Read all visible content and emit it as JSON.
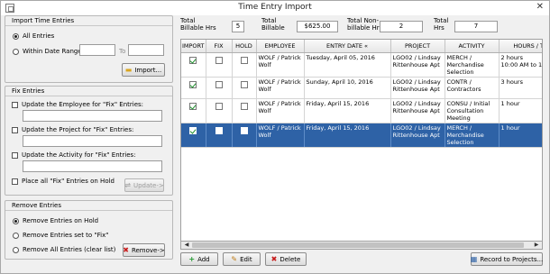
{
  "window": {
    "title": "Time Entry Import",
    "close_glyph": "✕"
  },
  "import_group": {
    "label": "Import Time Entries",
    "all_entries": "All Entries",
    "within_range": "Within Date Range:",
    "to_label": "To",
    "import_button": "Import..."
  },
  "fix_group": {
    "label": "Fix Entries",
    "update_employee": "Update the Employee for \"Fix\" Entries:",
    "update_project": "Update the Project for \"Fix\" Entries:",
    "update_activity": "Update the Activity for \"Fix\" Entries:",
    "place_on_hold": "Place all \"Fix\" Entries on Hold",
    "update_button": "Update->"
  },
  "remove_group": {
    "label": "Remove Entries",
    "remove_on_hold": "Remove Entries on Hold",
    "remove_fix": "Remove Entries set to \"Fix\"",
    "remove_all": "Remove All Entries (clear list)",
    "remove_button": "Remove->"
  },
  "stats": {
    "total_billable_hrs_label": "Total\nBillable Hrs",
    "total_billable_hrs": "5",
    "total_billable_label": "Total\nBillable",
    "total_billable": "$625.00",
    "total_nonbillable_label": "Total Non-\nbillable Hrs",
    "total_nonbillable": "2",
    "total_hrs_label": "Total\nHrs",
    "total_hrs": "7"
  },
  "grid": {
    "columns": [
      "IMPORT",
      "FIX",
      "HOLD",
      "EMPLOYEE",
      "ENTRY DATE «",
      "PROJECT",
      "ACTIVITY",
      "HOURS / TIME"
    ],
    "rows": [
      {
        "import": true,
        "fix": false,
        "hold": false,
        "employee": "WOLF / Patrick Wolf",
        "date": "Tuesday, April 05, 2016",
        "project": "LGO02 / Lindsay Rittenhouse Apt",
        "activity": "MERCH / Merchandise Selection",
        "hours": "2 hours\n10:00 AM to 12:00 PM"
      },
      {
        "import": true,
        "fix": false,
        "hold": false,
        "employee": "WOLF / Patrick Wolf",
        "date": "Sunday, April 10, 2016",
        "project": "LGO02 / Lindsay Rittenhouse Apt",
        "activity": "CONTR / Contractors",
        "hours": "3 hours"
      },
      {
        "import": true,
        "fix": false,
        "hold": false,
        "employee": "WOLF / Patrick Wolf",
        "date": "Friday, April 15, 2016",
        "project": "LGO02 / Lindsay Rittenhouse Apt",
        "activity": "CONSU / Initial Consultation Meeting",
        "hours": "1 hour"
      },
      {
        "import": true,
        "fix": false,
        "hold": false,
        "employee": "WOLF / Patrick Wolf",
        "date": "Friday, April 15, 2016",
        "project": "LGO02 / Lindsay Rittenhouse Apt",
        "activity": "MERCH / Merchandise Selection",
        "hours": "1 hour"
      }
    ],
    "selected_row": 3
  },
  "bottom_buttons": {
    "add": "Add",
    "edit": "Edit",
    "delete": "Delete",
    "record": "Record to Projects..."
  }
}
